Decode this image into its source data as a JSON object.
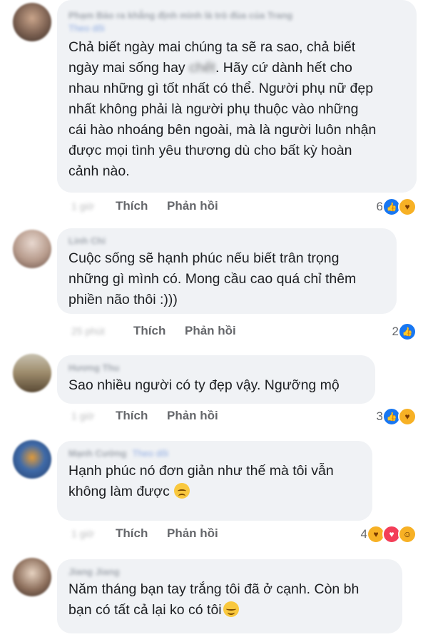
{
  "comments": [
    {
      "author": "Phạm Bảo ra khẳng định mình là trò đùa của Trang",
      "follow": "Theo dõi",
      "text_a": "Chả biết ngày mai chúng ta sẽ ra sao, chả biết\nngày mai sống hay ",
      "text_blur": "chết",
      "text_b": ". Hãy cứ dành hết cho\nnhau những gì tốt nhất có thể. Người phụ nữ đẹp\nnhất không phải là người phụ thuộc vào những\ncái hào nhoáng bên ngoài, mà là người luôn nhận\nđược mọi tình yêu thương dù cho bất kỳ hoàn\ncảnh nào.",
      "time": "1 giờ",
      "like": "Thích",
      "reply": "Phản hồi",
      "count": "6",
      "reactions": [
        "like-icon",
        "care-icon"
      ]
    },
    {
      "author": "Linh Chi",
      "text": "Cuộc sống sẽ hạnh phúc nếu biết trân trọng\nnhững gì mình có. Mong cầu cao quá chỉ thêm\nphiền não thôi :)))",
      "time": "25 phút",
      "like": "Thích",
      "reply": "Phản hồi",
      "count": "2",
      "reactions": [
        "like-icon"
      ]
    },
    {
      "author": "Hương Thu",
      "text": "Sao nhiều người có ty đẹp vậy. Ngưỡng mộ",
      "time": "1 giờ",
      "like": "Thích",
      "reply": "Phản hồi",
      "count": "3",
      "reactions": [
        "like-icon",
        "care-icon"
      ]
    },
    {
      "author": "Mạnh Cường",
      "follow": "Theo dõi",
      "text": "Hạnh phúc nó đơn giản như thế mà tôi vẫn\nkhông làm được",
      "time": "1 giờ",
      "like": "Thích",
      "reply": "Phản hồi",
      "count": "4",
      "reactions": [
        "care-icon",
        "love-icon",
        "haha-icon"
      ]
    },
    {
      "author": "Jiang Jiang",
      "text": "Năm tháng bạn tay trắng tôi đã ở cạnh. Còn bh\nbạn có tất cả lại ko có tôi"
    }
  ],
  "colors": {
    "bubble": "#f0f2f5",
    "like": "#1877f2",
    "love": "#f33e58",
    "care": "#f7b125",
    "muted_text": "#65676b"
  }
}
